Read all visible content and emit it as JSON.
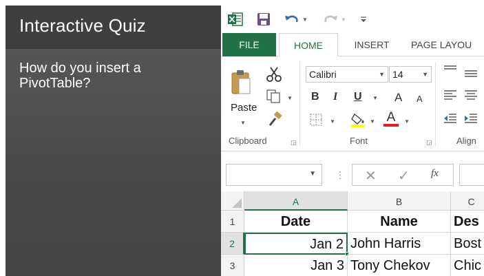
{
  "quiz": {
    "title": "Interactive Quiz",
    "question": "How do you insert a PivotTable?"
  },
  "excel": {
    "accent": "#217346",
    "tabs": {
      "file": "FILE",
      "home": "HOME",
      "insert": "INSERT",
      "page_layout": "PAGE LAYOU"
    },
    "clipboard": {
      "paste_label": "Paste",
      "group_label": "Clipboard"
    },
    "font": {
      "name": "Calibri",
      "size": "14",
      "bold": "B",
      "italic": "I",
      "underline": "U",
      "grow": "A",
      "shrink": "A",
      "font_color": "A",
      "group_label": "Font"
    },
    "alignment": {
      "group_label": "Align"
    },
    "formula_bar": {
      "fx_label": "fx"
    },
    "sheet": {
      "columns": [
        "A",
        "B",
        "C"
      ],
      "rows": [
        {
          "num": "1",
          "cells": [
            "Date",
            "Name",
            "Des"
          ]
        },
        {
          "num": "2",
          "cells": [
            "Jan 2",
            "John Harris",
            "Bost"
          ]
        },
        {
          "num": "3",
          "cells": [
            "Jan 3",
            "Tony Chekov",
            "Chic"
          ]
        }
      ]
    }
  }
}
